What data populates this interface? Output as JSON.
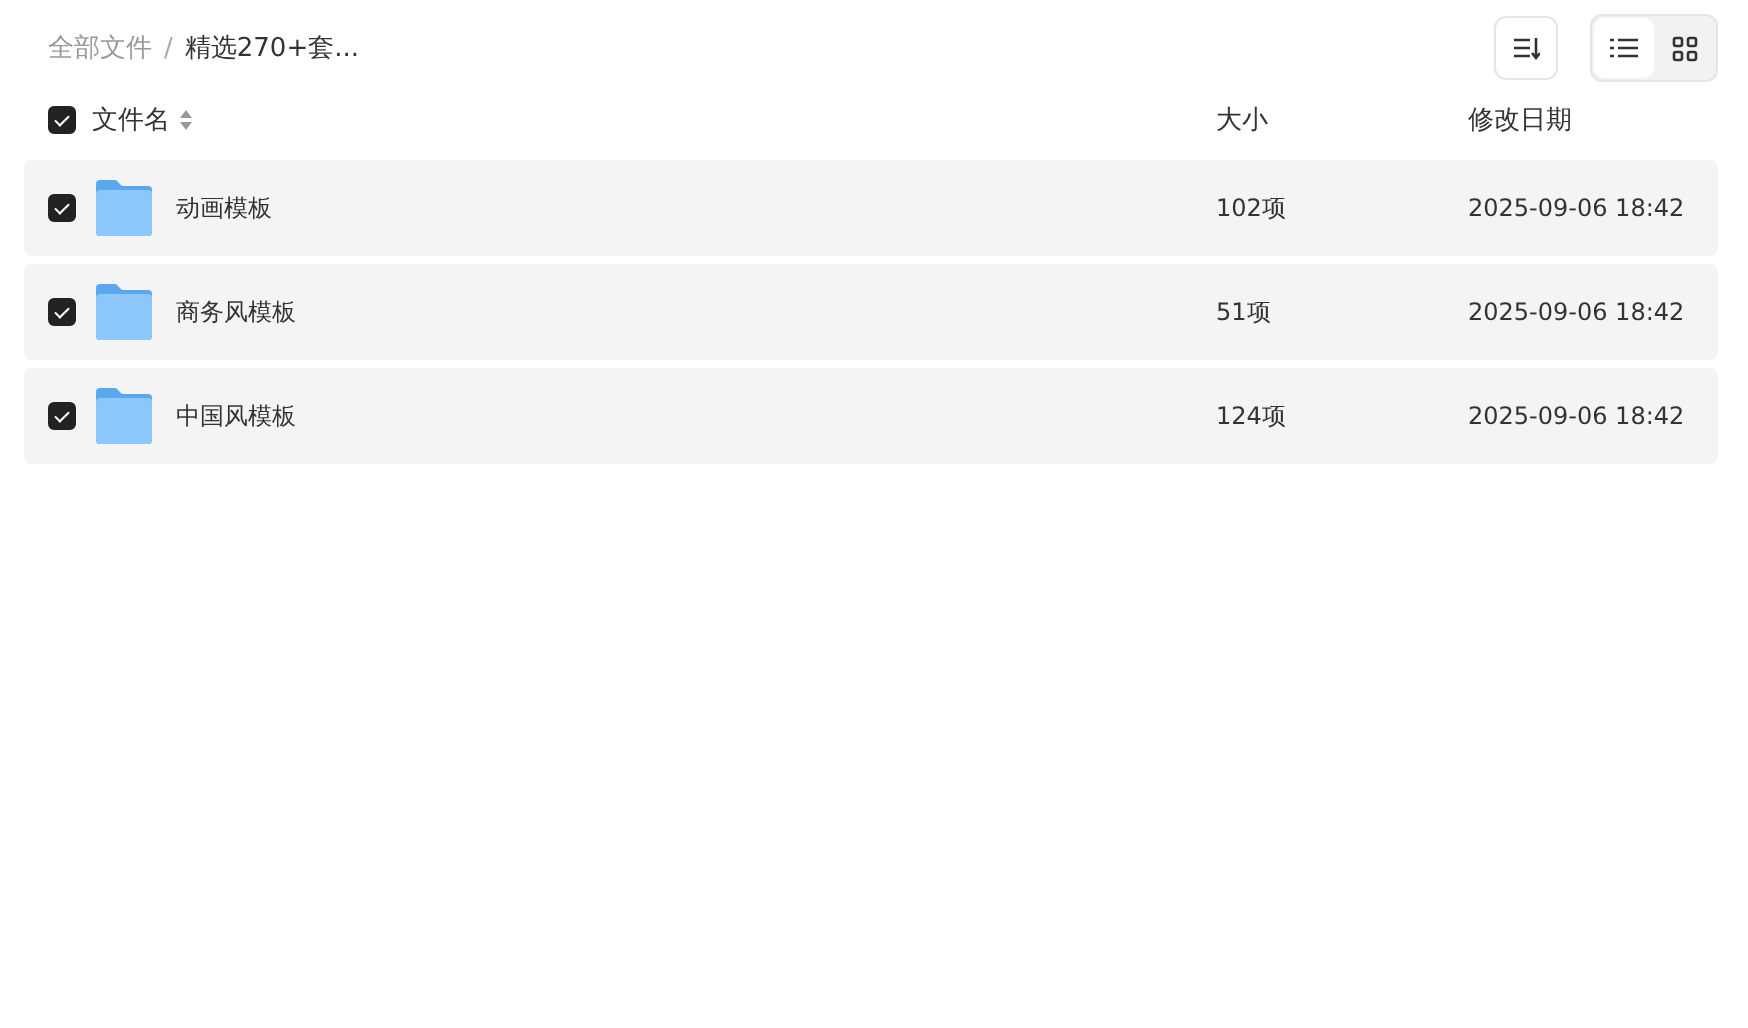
{
  "breadcrumb_separator": "/",
  "breadcrumb": [
    {
      "label": "全部文件",
      "current": false
    },
    {
      "label": "精选270+套...",
      "current": true
    }
  ],
  "toolbar": {
    "views": [
      {
        "kind": "list",
        "selected": true
      },
      {
        "kind": "grid",
        "selected": false
      }
    ]
  },
  "table": {
    "select_all": {
      "checked": true
    },
    "columns": [
      {
        "label": "文件名",
        "sortable": true
      },
      {
        "label": "大小",
        "sortable": false
      },
      {
        "label": "修改日期",
        "sortable": false
      }
    ],
    "rows": [
      {
        "checked": true,
        "name": "动画模板",
        "size": "102项",
        "modified": "2025-09-06 18:42"
      },
      {
        "checked": true,
        "name": "商务风模板",
        "size": "51项",
        "modified": "2025-09-06 18:42"
      },
      {
        "checked": true,
        "name": "中国风模板",
        "size": "124项",
        "modified": "2025-09-06 18:42"
      }
    ]
  }
}
